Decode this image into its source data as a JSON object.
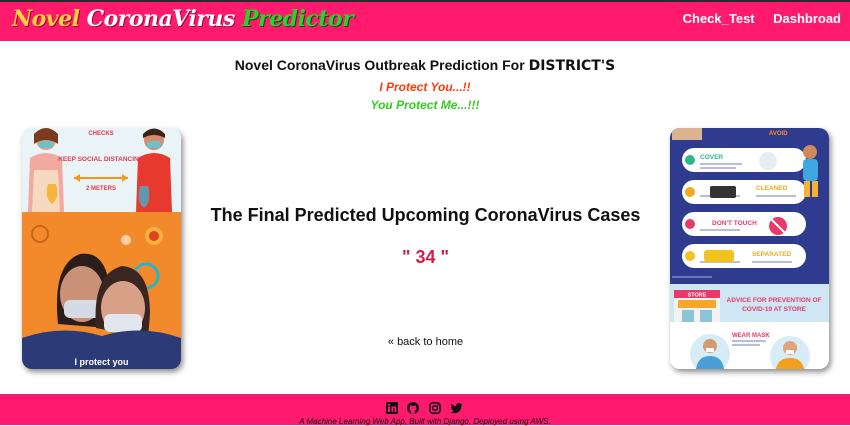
{
  "navbar": {
    "brand": {
      "part1": "Novel",
      "part2": "CoronaVirus",
      "part3": "Predictor"
    },
    "links": [
      "Check_Test",
      "Dashbroad"
    ],
    "bg_color": "#ff1a6e"
  },
  "header": {
    "title_prefix": "Novel CoronaVirus Outbreak Prediction For",
    "title_strong": "DISTRICT'S",
    "tagline_1": "I Protect You...!!",
    "tagline_2": "You Protect Me...!!!"
  },
  "left_card": {
    "sign_checks": "CHECKS",
    "sign_distancing": "KEEP SOCIAL DISTANCING",
    "sign_meters": "2 METERS",
    "caption": "I protect you"
  },
  "right_card": {
    "step_avoid": "AVOID",
    "step_cover": "COVER",
    "step_cleaned": "CLEANED",
    "step_dont_touch": "DON'T TOUCH",
    "step_separated": "SEPARATED",
    "store_sign": "STORE",
    "advice_title": "ADVICE FOR PREVENTION OF",
    "advice_title_2": "COVID-19 AT STORE",
    "wear_mask": "WEAR MASK"
  },
  "result": {
    "title": "The Final Predicted Upcoming CoronaVirus Cases",
    "value": "\" 34 \"",
    "back_link": "« back to home"
  },
  "footer": {
    "social_icons": [
      "linkedin-icon",
      "github-icon",
      "instagram-icon",
      "twitter-icon"
    ],
    "text": "A Machine Learning Web App, Built with Django, Deployed using AWS."
  },
  "colors": {
    "accent": "#ff1a6e",
    "value_red": "#d31f4a",
    "tagline_red": "#ff3a0a",
    "tagline_green": "#33cc1f"
  }
}
